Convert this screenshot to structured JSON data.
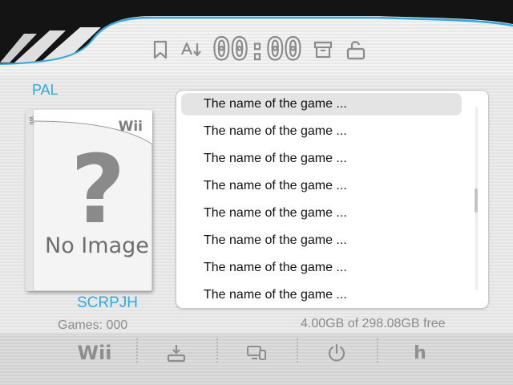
{
  "header": {
    "clock": "00:00",
    "icons": [
      "bookmark-icon",
      "sort-az-icon",
      "archive-icon",
      "unlock-icon"
    ],
    "accent_color": "#35a8e0",
    "dark_band_color": "#141414"
  },
  "left_panel": {
    "region": "PAL",
    "cover": {
      "brand": "Wii",
      "placeholder_symbol": "?",
      "caption": "No Image",
      "pattern": "?????????????????????????????????????????????????????????????????????????????????????????????????????????????????????????????????????????????????????????????????????????????????????????????????????????????????????????????????????????????????????????????????????????????????????????????????????????????????????????????????????????????????????????????????????????????????????????????????????????????????????????????????????????????????????????????????????????????????????????????????????????????????????????????????????????????????????????????"
    },
    "game_id": "SCRPJH",
    "games_count": "Games: 000"
  },
  "game_list": {
    "items": [
      {
        "label": "The name of the game ...",
        "selected": true
      },
      {
        "label": "The name of the game ...",
        "selected": false
      },
      {
        "label": "The name of the game ...",
        "selected": false
      },
      {
        "label": "The name of the game ...",
        "selected": false
      },
      {
        "label": "The name of the game ...",
        "selected": false
      },
      {
        "label": "The name of the game ...",
        "selected": false
      },
      {
        "label": "The name of the game ...",
        "selected": false
      },
      {
        "label": "The name of the game ...",
        "selected": false
      }
    ],
    "scroll_position": 0.45
  },
  "status": {
    "free_space": "4.00GB of 298.08GB free"
  },
  "toolbar": {
    "wii_label": "Wii",
    "install_icon": "install-icon",
    "settings_icon": "device-settings-icon",
    "power_icon": "power-icon",
    "homebrew_label": "h"
  }
}
